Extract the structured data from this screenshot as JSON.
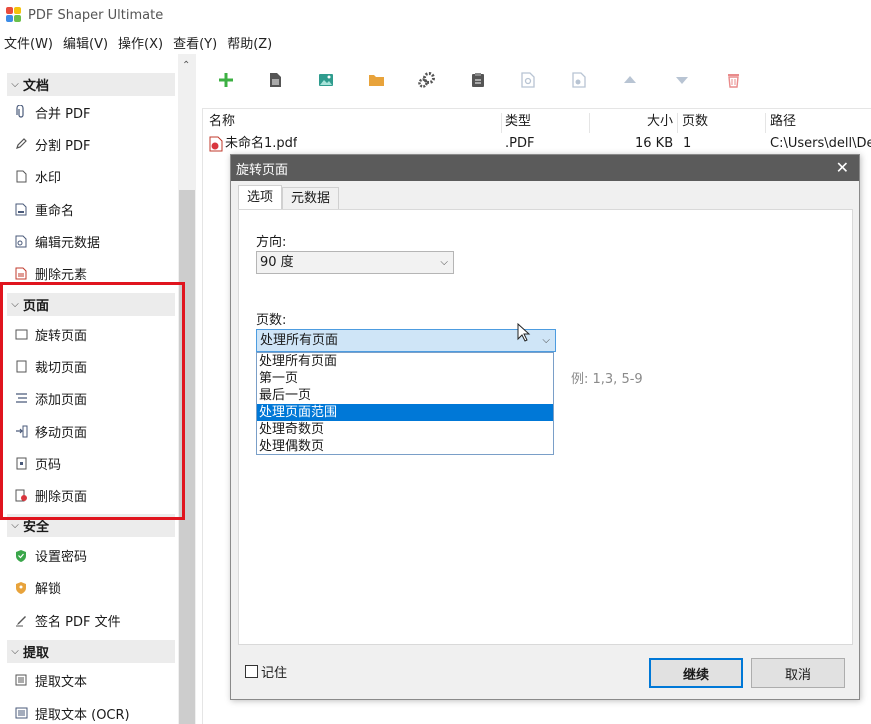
{
  "app": {
    "title": "PDF Shaper Ultimate"
  },
  "menu": [
    "文件(W)",
    "编辑(V)",
    "操作(X)",
    "查看(Y)",
    "帮助(Z)"
  ],
  "sidebar": {
    "groups": [
      {
        "label": "文档",
        "items": [
          "合并 PDF",
          "分割 PDF",
          "水印",
          "重命名",
          "编辑元数据",
          "删除元素"
        ]
      },
      {
        "label": "页面",
        "items": [
          "旋转页面",
          "裁切页面",
          "添加页面",
          "移动页面",
          "页码",
          "删除页面"
        ]
      },
      {
        "label": "安全",
        "items": [
          "设置密码",
          "解锁",
          "签名 PDF 文件"
        ]
      },
      {
        "label": "提取",
        "items": [
          "提取文本",
          "提取文本 (OCR)"
        ]
      }
    ]
  },
  "toolbar": {
    "icons": [
      "add-icon",
      "document-icon",
      "image-icon",
      "folder-icon",
      "gears-icon",
      "clipboard-icon",
      "search-document-icon",
      "settings-document-icon",
      "move-up-icon",
      "move-down-icon",
      "trash-icon"
    ],
    "colors": {
      "add": "#3cb043",
      "image": "#2f9c8e",
      "folder": "#e8a33b",
      "trash": "#e98b8b",
      "disabled": "#b8c4d3"
    }
  },
  "filelist": {
    "headers": {
      "name": "名称",
      "type": "类型",
      "size": "大小",
      "pages": "页数",
      "path": "路径"
    },
    "rows": [
      {
        "name": "未命名1.pdf",
        "type": ".PDF",
        "size": "16 KB",
        "pages": "1",
        "path": "C:\\Users\\dell\\De"
      }
    ]
  },
  "dialog": {
    "title": "旋转页面",
    "close": "✕",
    "tabs": [
      "选项",
      "元数据"
    ],
    "direction_label": "方向:",
    "direction_value": "90 度",
    "pages_label": "页数:",
    "pages_value": "处理所有页面",
    "pages_options": [
      "处理所有页面",
      "第一页",
      "最后一页",
      "处理页面范围",
      "处理奇数页",
      "处理偶数页"
    ],
    "selected_option_index": 3,
    "range_hint": "例: 1,3, 5-9",
    "remember_label": "记住",
    "continue_label": "继续",
    "cancel_label": "取消"
  },
  "colors": {
    "highlight": "#e0141e",
    "selection": "#0078d7",
    "titlebar": "#5b5b5b"
  }
}
